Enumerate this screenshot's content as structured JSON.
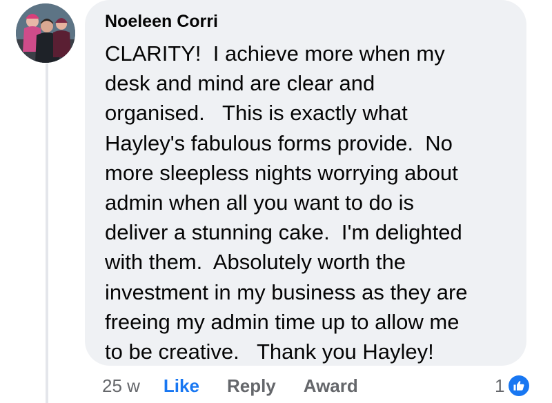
{
  "comment": {
    "author": "Noeleen Corri",
    "text_lines": [
      "CLARITY!  I achieve more when my",
      "desk and mind are clear and",
      "organised.   This is exactly what",
      "Hayley's fabulous forms provide.  No",
      "more sleepless nights worrying about",
      "admin when all you want to do is",
      "deliver a stunning cake.  I'm delighted",
      "with them.  Absolutely worth the",
      "investment in my business as they are",
      "freeing my admin time up to allow me",
      "to be creative.   Thank you Hayley!"
    ],
    "age": "25 w",
    "actions": {
      "like": "Like",
      "reply": "Reply",
      "award": "Award"
    },
    "reactions": {
      "count": "1",
      "icon": "thumbs-up-icon",
      "color": "#1877f2"
    }
  },
  "colors": {
    "bubble": "#eff1f4",
    "text": "#050505",
    "meta": "#65676b",
    "accent": "#1877f2"
  }
}
